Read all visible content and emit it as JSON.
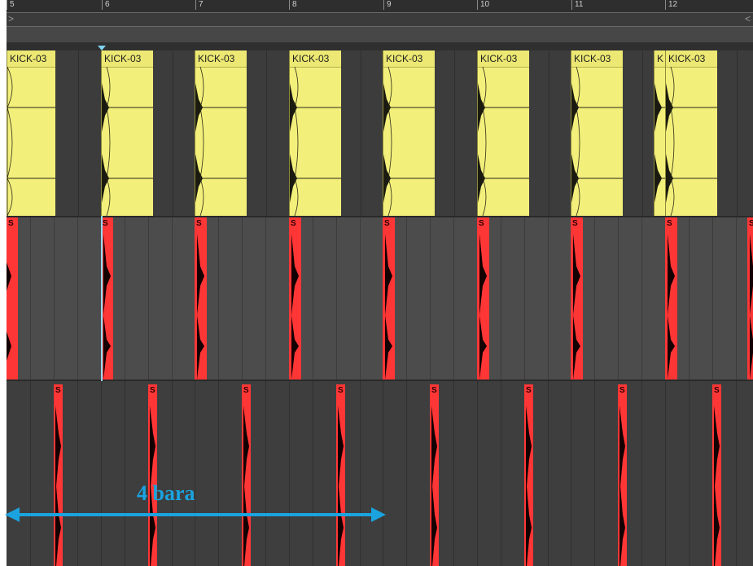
{
  "ruler": {
    "bar_numbers": [
      "5",
      "6",
      "7",
      "8",
      "9",
      "10",
      "11",
      "12"
    ],
    "loop_start_glyph": ">",
    "loop_end_glyph": "<"
  },
  "track1": {
    "clip_color": "#f3ef7b",
    "clips": [
      {
        "name": "KICK-03"
      },
      {
        "name": "KICK-03"
      },
      {
        "name": "KICK-03"
      },
      {
        "name": "KICK-03"
      },
      {
        "name": "KICK-03"
      },
      {
        "name": "KICK-03"
      },
      {
        "name": "KICK-03"
      },
      {
        "name": "K"
      },
      {
        "name": "KICK-03"
      }
    ]
  },
  "track2": {
    "clip_color": "#ff3636",
    "clips": [
      {
        "name": "S"
      },
      {
        "name": "S"
      },
      {
        "name": "S"
      },
      {
        "name": "S"
      },
      {
        "name": "S"
      },
      {
        "name": "S"
      },
      {
        "name": "S"
      },
      {
        "name": "S"
      },
      {
        "name": "S"
      }
    ]
  },
  "track3": {
    "clip_color": "#ff3636",
    "clips": [
      {
        "name": "S"
      },
      {
        "name": "S"
      },
      {
        "name": "S"
      },
      {
        "name": "S"
      },
      {
        "name": "S"
      },
      {
        "name": "S"
      },
      {
        "name": "S"
      },
      {
        "name": "S"
      }
    ]
  },
  "annotation": {
    "label": "4 bara",
    "color": "#1aa3df"
  }
}
